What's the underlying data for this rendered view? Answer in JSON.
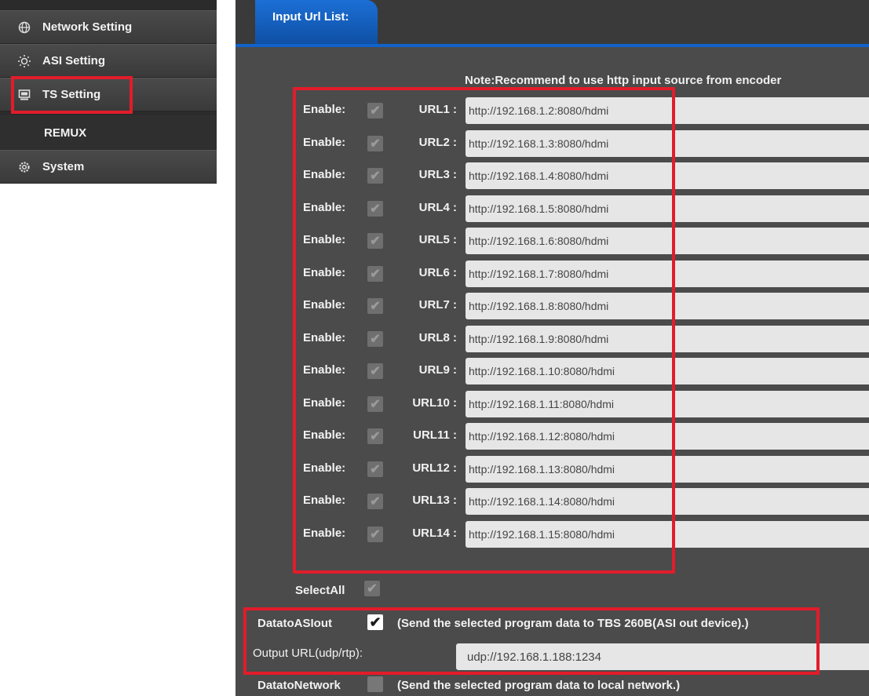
{
  "sidebar": {
    "items": [
      {
        "label": "Network Setting",
        "icon": "globe-icon"
      },
      {
        "label": "ASI Setting",
        "icon": "sun-icon"
      },
      {
        "label": "TS Setting",
        "icon": "monitor-icon"
      },
      {
        "label": "REMUX",
        "icon": ""
      },
      {
        "label": "System",
        "icon": "gear-icon"
      }
    ]
  },
  "tabs": [
    {
      "label": "Input Url List:"
    }
  ],
  "note": "Note:Recommend to use http input source from encoder",
  "enable_label": "Enable:",
  "urls": [
    {
      "label": "URL1 :",
      "value": "http://192.168.1.2:8080/hdmi",
      "enabled": true
    },
    {
      "label": "URL2 :",
      "value": "http://192.168.1.3:8080/hdmi",
      "enabled": true
    },
    {
      "label": "URL3 :",
      "value": "http://192.168.1.4:8080/hdmi",
      "enabled": true
    },
    {
      "label": "URL4 :",
      "value": "http://192.168.1.5:8080/hdmi",
      "enabled": true
    },
    {
      "label": "URL5 :",
      "value": "http://192.168.1.6:8080/hdmi",
      "enabled": true
    },
    {
      "label": "URL6 :",
      "value": "http://192.168.1.7:8080/hdmi",
      "enabled": true
    },
    {
      "label": "URL7 :",
      "value": "http://192.168.1.8:8080/hdmi",
      "enabled": true
    },
    {
      "label": "URL8 :",
      "value": "http://192.168.1.9:8080/hdmi",
      "enabled": true
    },
    {
      "label": "URL9 :",
      "value": "http://192.168.1.10:8080/hdmi",
      "enabled": true
    },
    {
      "label": "URL10 :",
      "value": "http://192.168.1.11:8080/hdmi",
      "enabled": true
    },
    {
      "label": "URL11 :",
      "value": "http://192.168.1.12:8080/hdmi",
      "enabled": true
    },
    {
      "label": "URL12 :",
      "value": "http://192.168.1.13:8080/hdmi",
      "enabled": true
    },
    {
      "label": "URL13 :",
      "value": "http://192.168.1.14:8080/hdmi",
      "enabled": true
    },
    {
      "label": "URL14 :",
      "value": "http://192.168.1.15:8080/hdmi",
      "enabled": true
    }
  ],
  "select_all": {
    "label": "SelectAll",
    "checked": true
  },
  "data_to_asi": {
    "label": "DatatoASIout",
    "checked": true,
    "description": "(Send the selected program data to TBS 260B(ASI out device).)"
  },
  "output_url": {
    "label": "Output URL(udp/rtp):",
    "value": "udp://192.168.1.188:1234"
  },
  "data_to_network": {
    "label": "DatatoNetwork",
    "checked": false,
    "description": "(Send the selected program data to local network.)"
  },
  "colors": {
    "accent": "#1163c9",
    "highlight": "#e21c2a",
    "panel": "#4b4b4b"
  }
}
